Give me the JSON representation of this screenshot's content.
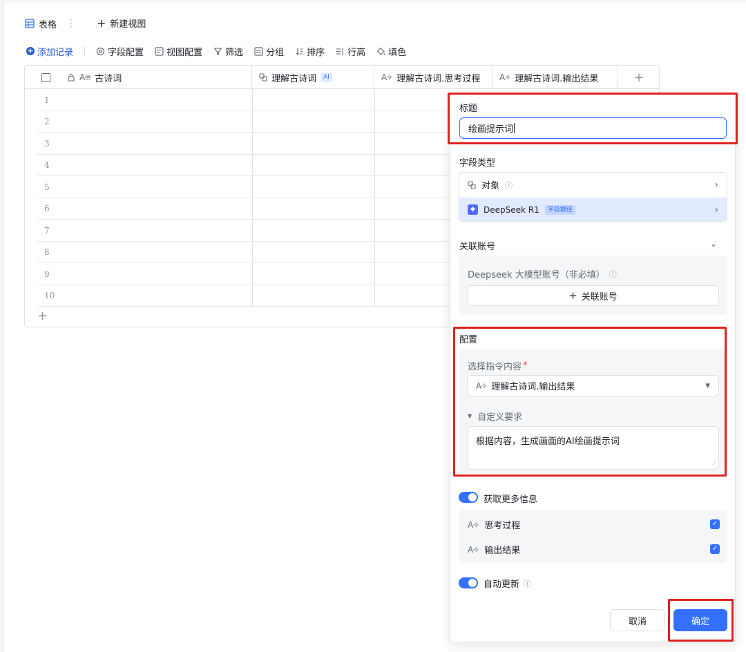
{
  "tabs": {
    "active_label": "表格",
    "more_glyph": "⋮",
    "new_view_label": "新建视图"
  },
  "toolbar": {
    "add_record": "添加记录",
    "field_config": "字段配置",
    "view_config": "视图配置",
    "filter": "筛选",
    "group": "分组",
    "sort": "排序",
    "row_height": "行高",
    "fill": "填色"
  },
  "table": {
    "columns": [
      {
        "label": "古诗词",
        "icon": "text-icon"
      },
      {
        "label": "理解古诗词",
        "icon": "object-icon",
        "tag": "AI"
      },
      {
        "label": "理解古诗词.思考过程",
        "icon": "ai-text-icon"
      },
      {
        "label": "理解古诗词.输出结果",
        "icon": "ai-text-icon"
      }
    ],
    "add_column_glyph": "+",
    "row_numbers": [
      "1",
      "2",
      "3",
      "4",
      "5",
      "6",
      "7",
      "8",
      "9",
      "10"
    ],
    "add_row_glyph": "+"
  },
  "panel": {
    "title_label": "标题",
    "title_value": "绘画提示词",
    "field_type_label": "字段类型",
    "field_type_object": "对象",
    "field_type_model": "DeepSeek R1",
    "field_type_model_tag": "字段捷径",
    "account_section_label": "关联账号",
    "account_field_label": "Deepseek 大模型账号（非必填）",
    "account_button": "关联账号",
    "config_label": "配置",
    "instruction_label": "选择指令内容",
    "required_mark": "*",
    "instruction_value": "理解古诗词.输出结果",
    "custom_req_label": "自定义要求",
    "custom_req_value": "根据内容，生成画面的AI绘画提示词",
    "more_info_label": "获取更多信息",
    "more_info_items": [
      "思考过程",
      "输出结果"
    ],
    "auto_update_label": "自动更新",
    "cancel": "取消",
    "confirm": "确定"
  },
  "colors": {
    "accent": "#3370ff",
    "highlight_border": "#e02020",
    "selected_row_bg": "#e1eaff"
  }
}
